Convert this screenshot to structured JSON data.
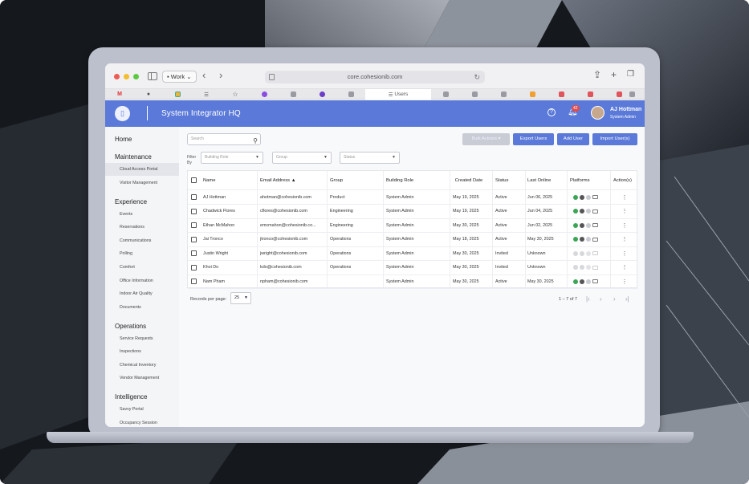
{
  "browser": {
    "profile": "Work",
    "url": "core.cohesionib.com",
    "active_tab": "Users"
  },
  "header": {
    "title": "System Integrator HQ",
    "notification_count": "42",
    "user_name": "AJ Hottman",
    "user_role": "System Admin"
  },
  "sidebar": {
    "home": "Home",
    "sections": [
      {
        "title": "Maintenance",
        "items": [
          "Cloud Access Portal",
          "Visitor Management"
        ]
      },
      {
        "title": "Experience",
        "items": [
          "Events",
          "Reservations",
          "Communications",
          "Polling",
          "Comfort",
          "Office Information",
          "Indoor Air Quality",
          "Documents"
        ]
      },
      {
        "title": "Operations",
        "items": [
          "Service Requests",
          "Inspections",
          "Chemical Inventory",
          "Vendor Management"
        ]
      },
      {
        "title": "Intelligence",
        "items": [
          "Savvy Portal",
          "Occupancy Session"
        ]
      }
    ],
    "active_item": "Cloud Access Portal"
  },
  "toolbar": {
    "search_placeholder": "Search",
    "bulk_actions": "Bulk Actions",
    "export_users": "Export Users",
    "add_user": "Add User",
    "import_users": "Import User(s)",
    "filter_by": "Filter By",
    "filter_building_role": "Building Role",
    "filter_group": "Group",
    "filter_status": "Status"
  },
  "table": {
    "headers": {
      "name": "Name",
      "email": "Email Address",
      "group": "Group",
      "building_role": "Building Role",
      "created_date": "Created Date",
      "status": "Status",
      "last_online": "Last Online",
      "platforms": "Platforms",
      "actions": "Action(s)"
    },
    "rows": [
      {
        "name": "AJ Hottman",
        "email": "ahotman@cohesionib.com",
        "group": "Product",
        "role": "System Admin",
        "created": "May 19, 2025",
        "status": "Active",
        "last_online": "Jun 06, 2025",
        "platforms_active": true
      },
      {
        "name": "Chadwick Flores",
        "email": "cflores@cohesionib.com",
        "group": "Engineering",
        "role": "System Admin",
        "created": "May 19, 2025",
        "status": "Active",
        "last_online": "Jun 04, 2025",
        "platforms_active": true
      },
      {
        "name": "Ethan McMahon",
        "email": "emcmahon@cohesionib.co...",
        "group": "Engineering",
        "role": "System Admin",
        "created": "May 30, 2025",
        "status": "Active",
        "last_online": "Jun 02, 2025",
        "platforms_active": true
      },
      {
        "name": "Jai Tronco",
        "email": "jtronco@cohesionib.com",
        "group": "Operations",
        "role": "System Admin",
        "created": "May 18, 2025",
        "status": "Active",
        "last_online": "May 30, 2025",
        "platforms_active": true
      },
      {
        "name": "Justin Wright",
        "email": "jwright@cohesionib.com",
        "group": "Operations",
        "role": "System Admin",
        "created": "May 30, 2025",
        "status": "Invited",
        "last_online": "Unknown",
        "platforms_active": false
      },
      {
        "name": "Khoi Do",
        "email": "kdo@cohesionib.com",
        "group": "Operations",
        "role": "System Admin",
        "created": "May 30, 2025",
        "status": "Invited",
        "last_online": "Unknown",
        "platforms_active": false
      },
      {
        "name": "Nam Pham",
        "email": "npham@cohesionib.com",
        "group": "",
        "role": "System Admin",
        "created": "May 30, 2025",
        "status": "Active",
        "last_online": "May 30, 2025",
        "platforms_active": true
      }
    ]
  },
  "pagination": {
    "records_label": "Records per page:",
    "per_page": "25",
    "range": "1 – 7 of 7"
  },
  "colors": {
    "accent": "#5a79d8",
    "header": "#5a79d8",
    "badge": "#e24b4b"
  }
}
